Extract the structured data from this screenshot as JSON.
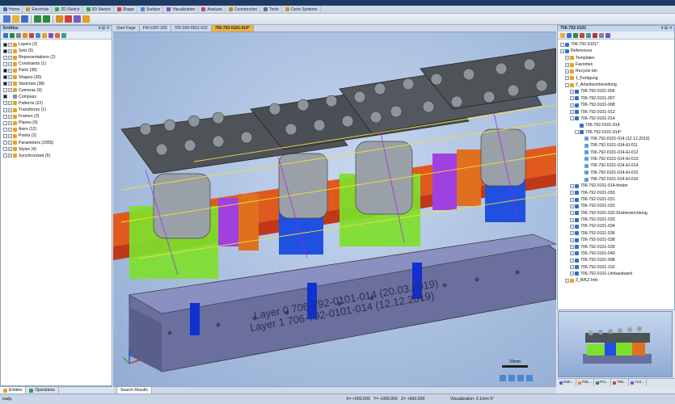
{
  "menu": {
    "items": [
      {
        "label": "Home",
        "icon": "home-icon",
        "color": "#3a6fbf"
      },
      {
        "label": "Electrode",
        "icon": "electrode-icon",
        "color": "#e38b1c"
      },
      {
        "label": "2D Sketch",
        "icon": "sketch-2d-icon",
        "color": "#3aa04a"
      },
      {
        "label": "3D Sketch",
        "icon": "sketch-3d-icon",
        "color": "#3aa04a"
      },
      {
        "label": "Shape",
        "icon": "shape-icon",
        "color": "#d04030"
      },
      {
        "label": "Surface",
        "icon": "surface-icon",
        "color": "#4a88d0"
      },
      {
        "label": "Visualization",
        "icon": "visualization-icon",
        "color": "#8050c0"
      },
      {
        "label": "Analysis",
        "icon": "analysis-icon",
        "color": "#c04080"
      },
      {
        "label": "Construction",
        "icon": "construction-icon",
        "color": "#d08020"
      },
      {
        "label": "Tools",
        "icon": "tools-icon",
        "color": "#607080"
      },
      {
        "label": "Certa Systems",
        "icon": "certa-icon",
        "color": "#e38b1c"
      }
    ]
  },
  "left_panel": {
    "title": "Entities",
    "buttons": "▾ ⊞ ✕",
    "items": [
      {
        "label": "Layers (2)",
        "checked": true,
        "expand": "+",
        "color": "#e8a020"
      },
      {
        "label": "Sets (5)",
        "checked": true,
        "expand": "+",
        "color": "#e8a020"
      },
      {
        "label": "Representations (2)",
        "checked": false,
        "expand": "+",
        "color": "#e8a020"
      },
      {
        "label": "Constraints (1)",
        "checked": false,
        "expand": "+",
        "color": "#e8a020"
      },
      {
        "label": "Parts (38)",
        "checked": true,
        "expand": "+",
        "color": "#e8a020"
      },
      {
        "label": "Shapes (30)",
        "checked": true,
        "expand": "+",
        "color": "#e8a020"
      },
      {
        "label": "Sketches (38)",
        "checked": true,
        "expand": "+",
        "color": "#e8a020"
      },
      {
        "label": "Cameras (9)",
        "checked": false,
        "expand": "+",
        "color": "#e8a020"
      },
      {
        "label": "Compass",
        "checked": true,
        "expand": "",
        "color": "#6090d0"
      },
      {
        "label": "Patterns (22)",
        "checked": false,
        "expand": "+",
        "color": "#e8a020"
      },
      {
        "label": "Transforms (1)",
        "checked": false,
        "expand": "+",
        "color": "#e8a020"
      },
      {
        "label": "Frames (3)",
        "checked": false,
        "expand": "+",
        "color": "#e8a020"
      },
      {
        "label": "Planes (9)",
        "checked": false,
        "expand": "+",
        "color": "#e8a020"
      },
      {
        "label": "Axes (12)",
        "checked": false,
        "expand": "+",
        "color": "#e8a020"
      },
      {
        "label": "Points (2)",
        "checked": false,
        "expand": "+",
        "color": "#e8a020"
      },
      {
        "label": "Parameters (2055)",
        "checked": false,
        "expand": "+",
        "color": "#e8a020"
      },
      {
        "label": "Styles (4)",
        "checked": false,
        "expand": "+",
        "color": "#e8a020"
      },
      {
        "label": "Synchronized (6)",
        "checked": false,
        "expand": "+",
        "color": "#e8a020"
      }
    ],
    "tabs": [
      "Entities",
      "Operations"
    ]
  },
  "doc_tabs": [
    "Start Page",
    "FM-1287-200",
    "705-309-0501-022",
    "706-792-0101-014*"
  ],
  "right_panel": {
    "title": "706-792-0101",
    "buttons": "▾ ⊞ ✕",
    "items": [
      {
        "label": "706-792-0101*",
        "indent": 0,
        "expand": "-",
        "color": "#3070c0"
      },
      {
        "label": "References",
        "indent": 0,
        "expand": "+",
        "color": "#3070c0"
      },
      {
        "label": "Templates",
        "indent": 1,
        "expand": "+",
        "color": "#e8a020"
      },
      {
        "label": "Favorites",
        "indent": 1,
        "expand": "+",
        "color": "#e8a020"
      },
      {
        "label": "Recycle bin",
        "indent": 1,
        "expand": "+",
        "color": "#e8a020"
      },
      {
        "label": "1_Fertigung",
        "indent": 1,
        "expand": "+",
        "color": "#e8a020"
      },
      {
        "label": "2_Arbeitsvorbereitung",
        "indent": 1,
        "expand": "-",
        "color": "#e8a020"
      },
      {
        "label": "706-792-0101-006",
        "indent": 2,
        "expand": "+",
        "color": "#3070c0"
      },
      {
        "label": "706-792-0101-007",
        "indent": 2,
        "expand": "+",
        "color": "#3070c0"
      },
      {
        "label": "706-792-0101-008",
        "indent": 2,
        "expand": "+",
        "color": "#3070c0"
      },
      {
        "label": "706-792-0101-012",
        "indent": 2,
        "expand": "+",
        "color": "#3070c0"
      },
      {
        "label": "706-792-0101-014",
        "indent": 2,
        "expand": "-",
        "color": "#3070c0"
      },
      {
        "label": "706-792-0101-014",
        "indent": 3,
        "expand": "",
        "color": "#3070c0"
      },
      {
        "label": "706-792-0101-014*",
        "indent": 3,
        "expand": "-",
        "color": "#3070c0"
      },
      {
        "label": "706-792-0101-014 (12.12.2019)",
        "indent": 4,
        "expand": "",
        "color": "#5aa0e0"
      },
      {
        "label": "706-792-0101-014-El-011",
        "indent": 4,
        "expand": "",
        "color": "#5aa0e0"
      },
      {
        "label": "706-792-0101-014-El-012",
        "indent": 4,
        "expand": "",
        "color": "#5aa0e0"
      },
      {
        "label": "706-792-0101-014-El-013",
        "indent": 4,
        "expand": "",
        "color": "#5aa0e0"
      },
      {
        "label": "706-792-0101-014-El-014",
        "indent": 4,
        "expand": "",
        "color": "#5aa0e0"
      },
      {
        "label": "706-792-0101-014-El-015",
        "indent": 4,
        "expand": "",
        "color": "#5aa0e0"
      },
      {
        "label": "706-792-0101-014-El-016",
        "indent": 4,
        "expand": "",
        "color": "#5aa0e0"
      },
      {
        "label": "706-792-0101-014-hinten",
        "indent": 2,
        "expand": "+",
        "color": "#3070c0"
      },
      {
        "label": "706-792-0101-030",
        "indent": 2,
        "expand": "+",
        "color": "#3070c0"
      },
      {
        "label": "706-792-0101-031",
        "indent": 2,
        "expand": "+",
        "color": "#3070c0"
      },
      {
        "label": "706-792-0101-032",
        "indent": 2,
        "expand": "+",
        "color": "#3070c0"
      },
      {
        "label": "706-792-0101-032-Drahtvorrichtung",
        "indent": 2,
        "expand": "+",
        "color": "#3070c0"
      },
      {
        "label": "706-792-0101-033",
        "indent": 2,
        "expand": "+",
        "color": "#3070c0"
      },
      {
        "label": "706-792-0101-034",
        "indent": 2,
        "expand": "+",
        "color": "#3070c0"
      },
      {
        "label": "706-792-0101-036",
        "indent": 2,
        "expand": "+",
        "color": "#3070c0"
      },
      {
        "label": "706-792-0101-038",
        "indent": 2,
        "expand": "+",
        "color": "#3070c0"
      },
      {
        "label": "706-792-0101-039",
        "indent": 2,
        "expand": "+",
        "color": "#3070c0"
      },
      {
        "label": "706-792-0101-040",
        "indent": 2,
        "expand": "+",
        "color": "#3070c0"
      },
      {
        "label": "706-792-0101-098",
        "indent": 2,
        "expand": "+",
        "color": "#3070c0"
      },
      {
        "label": "706-792-0101-102",
        "indent": 2,
        "expand": "+",
        "color": "#3070c0"
      },
      {
        "label": "706-792-0101-Umbauboard",
        "indent": 2,
        "expand": "+",
        "color": "#3070c0"
      },
      {
        "label": "3_WKZ-Info",
        "indent": 1,
        "expand": "+",
        "color": "#e8a020"
      }
    ],
    "tabs": [
      "Dek...",
      "705...",
      "Pro...",
      "706...",
      "714..."
    ]
  },
  "viewport": {
    "scale_label": "20mm",
    "engraving_1": "Layer 0 706-792-0101-014 (20.03.2019)",
    "engraving_2": "Layer 1 706-792-0101-014 (12.12.2019)",
    "view_tab": "Search Results"
  },
  "status": {
    "text": "eady.",
    "x": "X= +000,000",
    "y": "Y= +000,000",
    "z": "Z= +000,000",
    "visualization": "Visualization: 0,1mm 5°"
  }
}
